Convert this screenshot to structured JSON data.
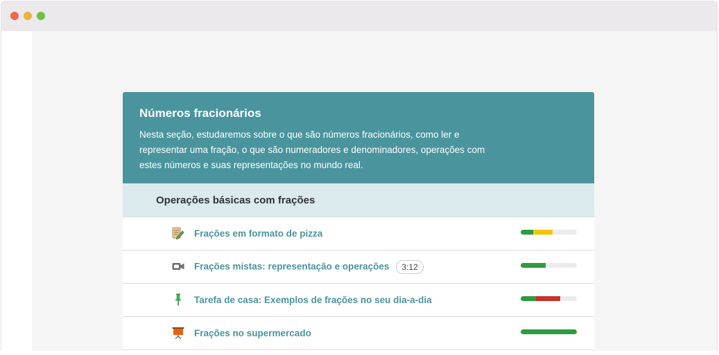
{
  "section": {
    "title": "Números fracionários",
    "description": "Nesta seção, estudaremos sobre o que são números fracionários, como ler e representar uma fração, o que são numeradores e denominadores, operações com estes números e suas representações no mundo real."
  },
  "subsection": {
    "title": "Operações básicas com frações"
  },
  "items": [
    {
      "label": "Frações em formato de pizza",
      "icon": "exercise-pencil-icon",
      "badge": "",
      "progress": [
        {
          "color": "#2e9c3e",
          "fraction": 0.22
        },
        {
          "color": "#f5c400",
          "fraction": 0.35
        }
      ]
    },
    {
      "label": "Frações mistas: representação e operações",
      "icon": "video-camera-icon",
      "badge": "3:12",
      "progress": [
        {
          "color": "#2e9c3e",
          "fraction": 0.44
        }
      ]
    },
    {
      "label": "Tarefa de casa: Exemplos de frações no seu dia-a-dia",
      "icon": "pushpin-icon",
      "badge": "",
      "progress": [
        {
          "color": "#2e9c3e",
          "fraction": 0.27
        },
        {
          "color": "#c8312a",
          "fraction": 0.43
        }
      ]
    },
    {
      "label": "Frações no supermercado",
      "icon": "presentation-board-icon",
      "badge": "",
      "progress": [
        {
          "color": "#2e9c3e",
          "fraction": 1.0
        }
      ]
    }
  ]
}
